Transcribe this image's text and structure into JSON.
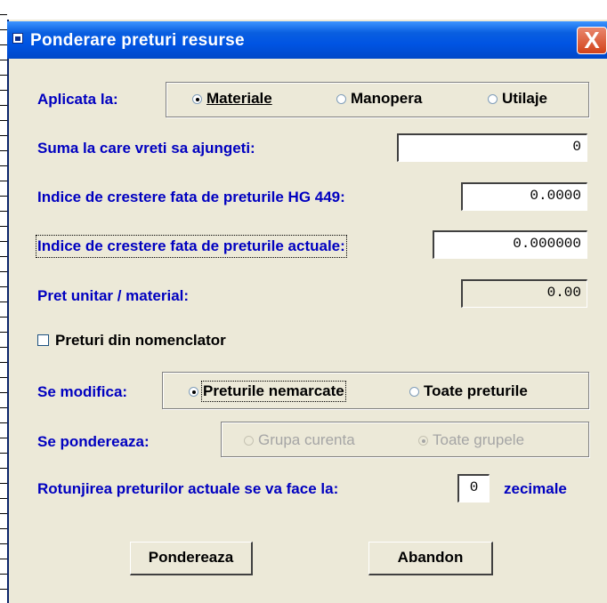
{
  "window": {
    "title": "Ponderare preturi resurse",
    "close_label": "X"
  },
  "aplicata": {
    "label": "Aplicata la:",
    "options": [
      "Materiale",
      "Manopera",
      "Utilaje"
    ],
    "selected": "Materiale"
  },
  "suma": {
    "label": "Suma la care vreti sa ajungeti:",
    "value": "0"
  },
  "indice_hg": {
    "label": "Indice de crestere fata de preturile HG 449:",
    "value": "0.0000"
  },
  "indice_actuale": {
    "label": "Indice de crestere fata de preturile actuale:",
    "value": "0.000000"
  },
  "pret_unitar": {
    "label": "Pret unitar / material:",
    "value": "0.00"
  },
  "nomenclator": {
    "label": "Preturi din nomenclator",
    "checked": false
  },
  "se_modifica": {
    "label": "Se modifica:",
    "options": [
      "Preturile nemarcate",
      "Toate preturile"
    ],
    "selected": "Preturile nemarcate"
  },
  "se_pondereaza": {
    "label": "Se pondereaza:",
    "options": [
      "Grupa curenta",
      "Toate grupele"
    ],
    "selected": "Toate grupele"
  },
  "rotunjire": {
    "label": "Rotunjirea preturilor actuale se va face la:",
    "value": "0",
    "suffix": "zecimale"
  },
  "buttons": {
    "pondereaza": "Pondereaza",
    "abandon": "Abandon"
  }
}
